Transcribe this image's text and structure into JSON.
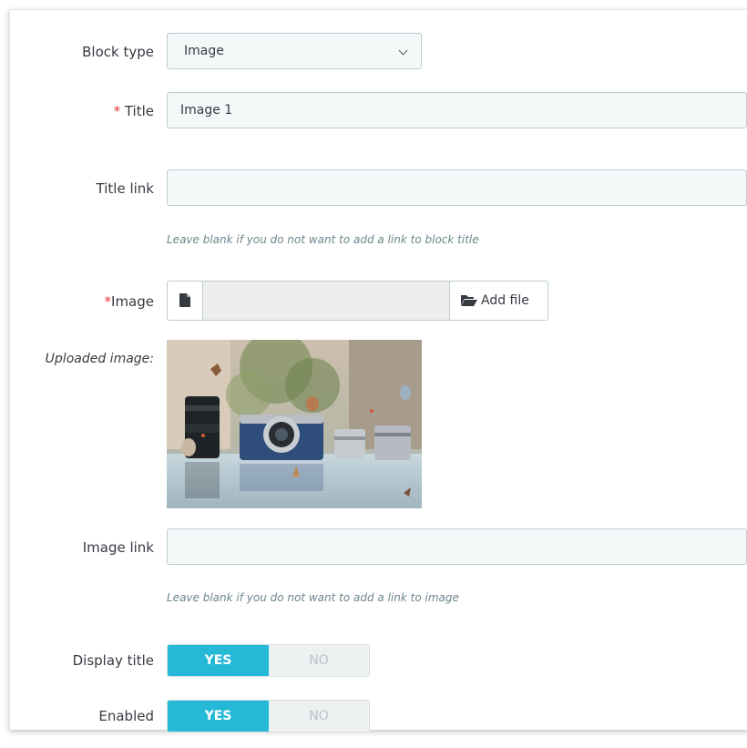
{
  "form": {
    "block_type": {
      "label": "Block type",
      "value": "Image"
    },
    "title": {
      "required_mark": "*",
      "label": "Title",
      "value": "Image 1"
    },
    "title_link": {
      "label": "Title link",
      "value": "",
      "help": "Leave blank if you do not want to add a link to block title"
    },
    "image": {
      "required_mark": "*",
      "label": "Image",
      "add_file_label": "Add file"
    },
    "uploaded_image": {
      "label": "Uploaded image:"
    },
    "image_link": {
      "label": "Image link",
      "value": "",
      "help": "Leave blank if you do not want to add a link to image"
    },
    "display_title": {
      "label": "Display title",
      "yes": "YES",
      "no": "NO",
      "selected": "YES"
    },
    "enabled": {
      "label": "Enabled",
      "yes": "YES",
      "no": "NO",
      "selected": "YES"
    }
  },
  "colors": {
    "accent": "#25b9d7",
    "required": "#e53935",
    "input_bg": "#f5f8f9",
    "input_border": "#bbcdd2",
    "help_text": "#6c868e"
  },
  "icons": [
    "chevron-down-icon",
    "file-icon",
    "folder-open-icon"
  ]
}
